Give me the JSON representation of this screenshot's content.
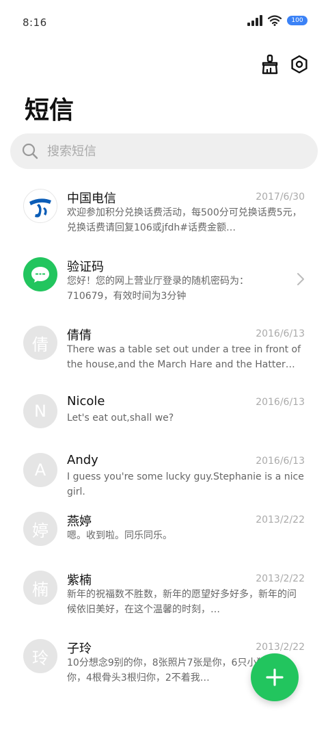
{
  "status_bar": {
    "time": "8:16",
    "battery": "100"
  },
  "header": {
    "title": "短信"
  },
  "search": {
    "placeholder": "搜索短信"
  },
  "messages": [
    {
      "sender": "中国电信",
      "date": "2017/6/30",
      "preview": "欢迎参加积分兑换话费活动，每500分可兑换话费5元，兑换话费请回复106或jfdh#话费金额…",
      "avatar_type": "logo"
    },
    {
      "sender": "验证码",
      "date": "",
      "preview": "您好！您的网上营业厅登录的随机密码为：710679，有效时间为3分钟",
      "avatar_type": "chat"
    },
    {
      "sender": "倩倩",
      "date": "2016/6/13",
      "preview": "There was a table set out under a tree in front of the house,and the March Hare and the Hatter were having …",
      "avatar_letter": "倩"
    },
    {
      "sender": "Nicole",
      "date": "2016/6/13",
      "preview": "Let's eat out,shall we?",
      "avatar_letter": "N"
    },
    {
      "sender": "Andy",
      "date": "2016/6/13",
      "preview": "I guess you're some lucky guy.Stephanie is a nice girl.",
      "avatar_letter": "A"
    },
    {
      "sender": "燕婷",
      "date": "2013/2/22",
      "preview": "嗯。收到啦。同乐同乐。",
      "avatar_letter": "婷"
    },
    {
      "sender": "紫楠",
      "date": "2013/2/22",
      "preview": "新年的祝福数不胜数，新年的愿望好多好多，新年的问候依旧美好，在这个温馨的时刻，…",
      "avatar_letter": "楠"
    },
    {
      "sender": "子玲",
      "date": "2013/2/22",
      "preview": "10分想念9别的你，8张照片7张是你，6只小狗5只像你，4根骨头3根归你，2不着我…",
      "avatar_letter": "玲"
    }
  ],
  "colors": {
    "accent": "#22c55e",
    "brand_blue": "#0b5db7"
  },
  "icons": [
    "clean-icon",
    "settings-icon",
    "search-icon",
    "add-icon",
    "chevron-right-icon"
  ]
}
